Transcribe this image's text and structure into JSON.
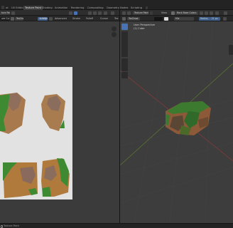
{
  "workspace_tabs": [
    "ut",
    "UV Editing",
    "Texture Paint",
    "Shading",
    "Animation",
    "Rendering",
    "Compositing",
    "Geometry Nodes",
    "Scripting"
  ],
  "uv_editor": {
    "editor_label": "ture Paint",
    "mode_label": "Texture Paint",
    "image_label": "ure Cubo",
    "brush_label": "TexDraw",
    "strength_label": "Strength",
    "strength_value": "1.000",
    "menu_advanced": "Advanced",
    "menu_stroke": "Stroke",
    "menu_falloff": "Falloff",
    "menu_cursor": "Cursor",
    "menu_tex": "Tex"
  },
  "viewport": {
    "mode_label": "Texture Paint",
    "view_label": "View",
    "brush_label": "Rock Base Colors",
    "brush_field": "TexDraw",
    "blend_label": "Mix",
    "radius_label": "Radius",
    "radius_value": "21 px",
    "view_name": "User Perspective",
    "object_name": "(1) Cube"
  },
  "status": {
    "text": "Texture Paint"
  },
  "colors": {
    "uv_background": "#e2e2e2",
    "grass": "#3d8a33",
    "soil": "#b07a3c",
    "dirt": "#8a6a58",
    "accent": "#4772b3"
  }
}
